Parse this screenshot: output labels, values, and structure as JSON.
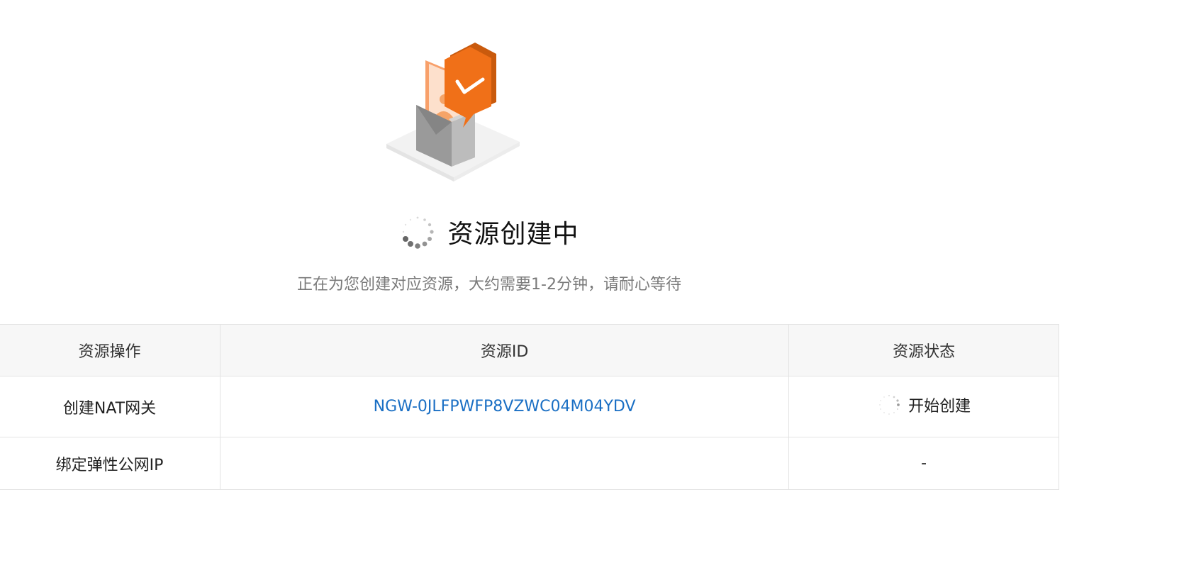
{
  "status": {
    "title": "资源创建中",
    "subtitle": "正在为您创建对应资源，大约需要1-2分钟，请耐心等待"
  },
  "table": {
    "headers": {
      "operation": "资源操作",
      "resource_id": "资源ID",
      "resource_status": "资源状态"
    },
    "rows": [
      {
        "operation": "创建NAT网关",
        "resource_id": "NGW-0JLFPWFP8VZWC04M04YDV",
        "resource_status": "开始创建"
      },
      {
        "operation": "绑定弹性公网IP",
        "resource_id": "",
        "resource_status": "-"
      }
    ]
  },
  "colors": {
    "accent": "#f07018",
    "link": "#1a6fc4",
    "subtitle": "#7a7a7a"
  }
}
